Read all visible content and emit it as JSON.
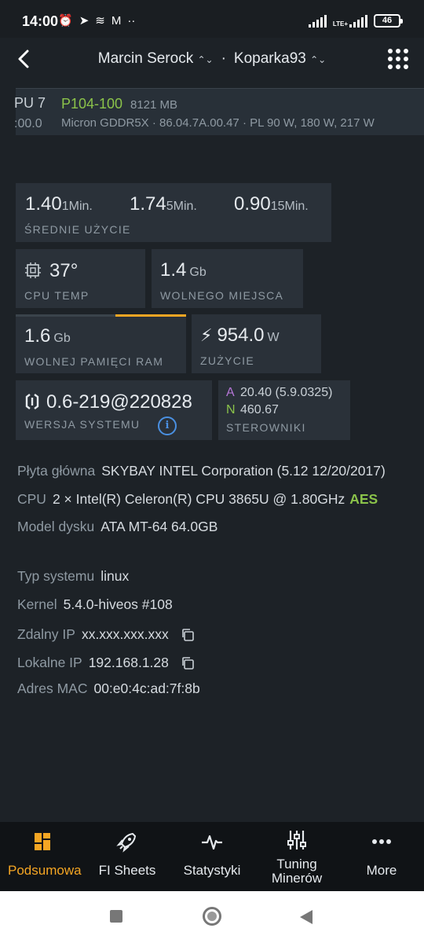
{
  "status_bar": {
    "time": "14:00",
    "notif_icons": [
      "alarm-icon",
      "telegram-icon",
      "speed-icon",
      "gmail-icon",
      "more-dots-icon"
    ],
    "network": "LTE+",
    "battery": "46"
  },
  "header": {
    "farm": "Marcin Serock",
    "separator": "·",
    "worker": "Koparka93",
    "arrows": "⌃⌄"
  },
  "gpu": {
    "index": "PU 7",
    "bus": ":00.0",
    "model": "P104-100",
    "memory": "8121 MB",
    "detail": "Micron GDDR5X · 86.04.7A.00.47 · PL 90 W, 180 W, 217 W"
  },
  "load": {
    "values": [
      {
        "value": "1.40",
        "unit": "1Min."
      },
      {
        "value": "1.74",
        "unit": "5Min."
      },
      {
        "value": "0.90",
        "unit": "15Min."
      }
    ],
    "label": "ŚREDNIE UŻYCIE"
  },
  "cpu_temp": {
    "value": "37°",
    "label": "CPU TEMP"
  },
  "disk": {
    "value": "1.4",
    "unit": "Gb",
    "label": "WOLNEGO MIEJSCA"
  },
  "ram": {
    "value": "1.6",
    "unit": "Gb",
    "label": "WOLNEJ PAMIĘCI RAM"
  },
  "power": {
    "value": "954.0",
    "unit": "W",
    "label": "ZUŻYCIE"
  },
  "os": {
    "value": "0.6-219@220828",
    "label": "WERSJA SYSTEMU",
    "info": "i"
  },
  "drivers": {
    "amd_tag": "A",
    "amd_value": "20.40 (5.9.0325)",
    "nvidia_tag": "N",
    "nvidia_value": "460.67",
    "label": "STEROWNIKI",
    "amd_color": "#b576d6",
    "nvidia_color": "#8bc34a"
  },
  "hardware": {
    "mobo_key": "Płyta główna",
    "mobo_val": "SKYBAY INTEL Corporation (5.12 12/20/2017)",
    "cpu_key": "CPU",
    "cpu_val": "2 × Intel(R) Celeron(R) CPU 3865U @ 1.80GHz",
    "cpu_flag": "AES",
    "disk_key": "Model dysku",
    "disk_val": "ATA MT-64 64.0GB"
  },
  "system": {
    "type_key": "Typ systemu",
    "type_val": "linux",
    "kernel_key": "Kernel",
    "kernel_val": "5.4.0-hiveos #108",
    "remote_key": "Zdalny IP",
    "remote_val": "xx.xxx.xxx.xxx",
    "local_key": "Lokalne IP",
    "local_val": "192.168.1.28",
    "mac_key": "Adres MAC",
    "mac_val": "00:e0:4c:ad:7f:8b"
  },
  "nav": {
    "summary": "Podsumowa",
    "fi_sheets": "FI Sheets",
    "stats": "Statystyki",
    "tuning_1": "Tuning",
    "tuning_2": "Minerów",
    "more": "More",
    "active_color": "#f5a623"
  }
}
